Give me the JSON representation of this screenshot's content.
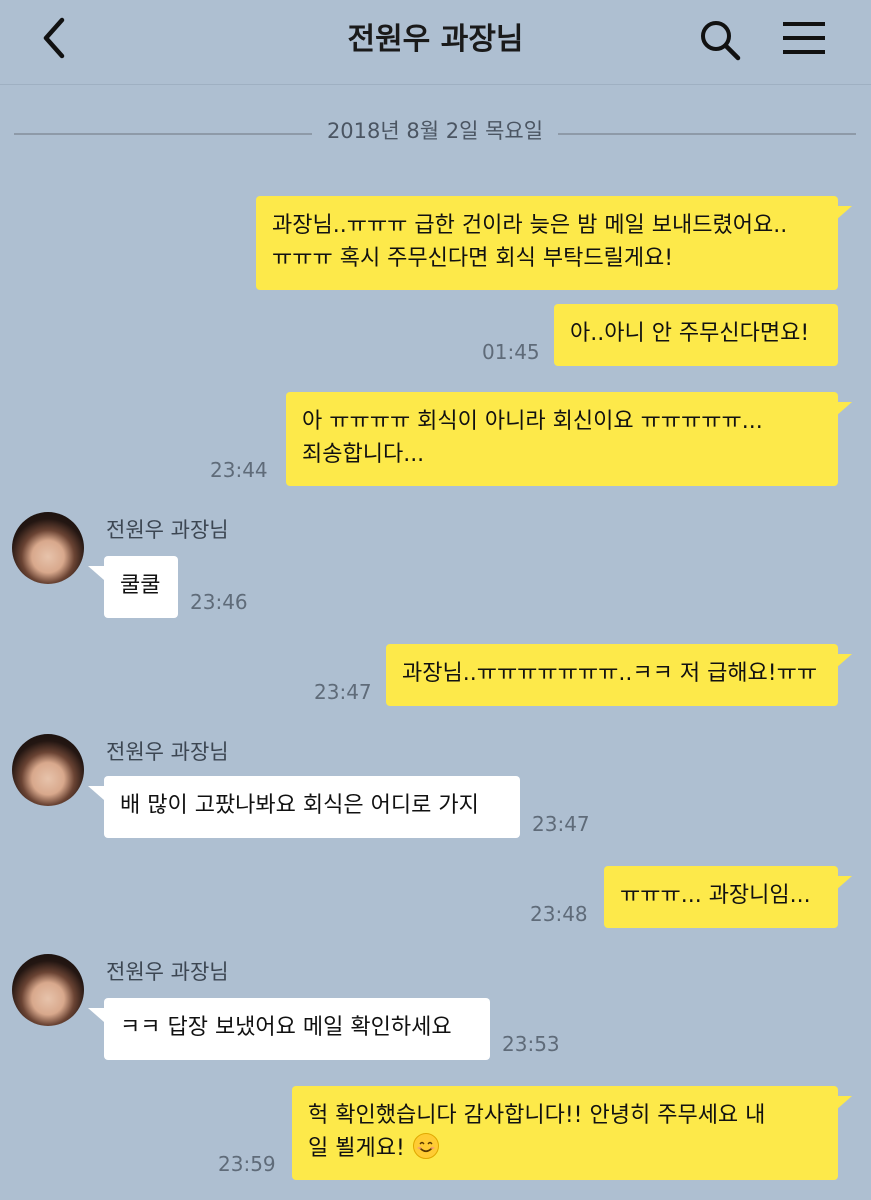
{
  "header": {
    "title": "전원우 과장님",
    "back_icon": "chevron-left-icon",
    "search_icon": "search-icon",
    "menu_icon": "hamburger-menu-icon"
  },
  "date_divider": "2018년 8월 2일 목요일",
  "colors": {
    "background": "#aebfd1",
    "my_bubble": "#fde94a",
    "their_bubble": "#ffffff"
  },
  "messages": [
    {
      "sender": "me",
      "lines": [
        "과장님..ㅠㅠㅠ 급한 건이라 늦은 밤 메일 보내드렸어요..",
        "ㅠㅠㅠ 혹시 주무신다면 회식 부탁드릴게요!"
      ],
      "time": ""
    },
    {
      "sender": "me",
      "lines": [
        "아..아니 안 주무신다면요!"
      ],
      "time": "01:45"
    },
    {
      "sender": "me",
      "lines": [
        "아 ㅠㅠㅠㅠ 회식이 아니라 회신이요 ㅠㅠㅠㅠㅠ...",
        "죄송합니다..."
      ],
      "time": "23:44"
    },
    {
      "sender": "them",
      "name": "전원우 과장님",
      "lines": [
        "쿨쿨"
      ],
      "time": "23:46"
    },
    {
      "sender": "me",
      "lines": [
        "과장님..ㅠㅠㅠㅠㅠㅠㅠ..ㅋㅋ 저 급해요!ㅠㅠ"
      ],
      "time": "23:47"
    },
    {
      "sender": "them",
      "name": "전원우 과장님",
      "lines": [
        "배 많이 고팠나봐요 회식은 어디로 가지"
      ],
      "time": "23:47"
    },
    {
      "sender": "me",
      "lines": [
        "ㅠㅠㅠ... 과장니임..."
      ],
      "time": "23:48"
    },
    {
      "sender": "them",
      "name": "전원우 과장님",
      "lines": [
        "ㅋㅋ 답장 보냈어요 메일 확인하세요"
      ],
      "time": "23:53"
    },
    {
      "sender": "me",
      "lines": [
        "헉 확인했습니다 감사합니다!! 안녕히 주무세요 내",
        "일 뵐게요!"
      ],
      "emoji": "smiling-face-emoji",
      "time": "23:59"
    }
  ]
}
